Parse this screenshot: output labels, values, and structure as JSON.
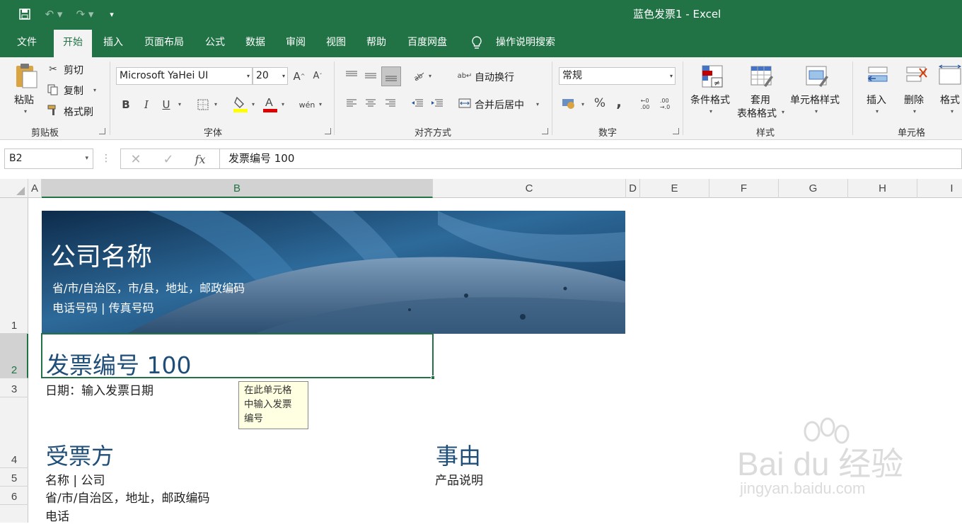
{
  "window": {
    "title": "蓝色发票1  -  Excel"
  },
  "menu_tabs": [
    "文件",
    "开始",
    "插入",
    "页面布局",
    "公式",
    "数据",
    "审阅",
    "视图",
    "帮助",
    "百度网盘",
    "操作说明搜索"
  ],
  "ribbon": {
    "clipboard": {
      "paste": "粘贴",
      "cut": "剪切",
      "copy": "复制",
      "format_painter": "格式刷",
      "label": "剪贴板"
    },
    "font": {
      "name": "Microsoft YaHei UI",
      "size": "20",
      "bold": "B",
      "italic": "I",
      "underline": "U",
      "label": "字体"
    },
    "alignment": {
      "wrap_text": "自动换行",
      "merge_center": "合并后居中",
      "label": "对齐方式"
    },
    "number": {
      "format": "常规",
      "percent": "%",
      "comma": ",",
      "label": "数字"
    },
    "styles": {
      "conditional_format": "条件格式",
      "format_as_table_1": "套用",
      "format_as_table_2": "表格格式",
      "cell_styles": "单元格样式",
      "label": "样式"
    },
    "cells": {
      "insert": "插入",
      "delete": "删除",
      "format": "格式",
      "label": "单元格"
    }
  },
  "formula_bar": {
    "name_box": "B2",
    "fx": "fx",
    "formula": "发票编号 100"
  },
  "columns": [
    "A",
    "B",
    "C",
    "D",
    "E",
    "F",
    "G",
    "H",
    "I"
  ],
  "rows": [
    "1",
    "2",
    "3",
    "4",
    "5",
    "6"
  ],
  "sheet": {
    "banner": {
      "company_name": "公司名称",
      "address": "省/市/自治区，市/县，地址，邮政编码",
      "phone_fax": "电话号码 | 传真号码"
    },
    "invoice_number": "发票编号 100",
    "date": "日期：输入发票日期",
    "bill_to_heading": "受票方",
    "reason_heading": "事由",
    "bill_to_name": "名称 | 公司",
    "product_desc": "产品说明",
    "bill_to_address": "省/市/自治区，地址，邮政编码",
    "bill_to_phone": "电话"
  },
  "tooltip": {
    "line1": "在此单元格",
    "line2": "中输入发票",
    "line3": "编号"
  },
  "watermark": {
    "brand": "Bai du 经验",
    "url": "jingyan.baidu.com"
  },
  "colors": {
    "excel_green": "#217346",
    "heading_blue": "#1f4e79"
  }
}
